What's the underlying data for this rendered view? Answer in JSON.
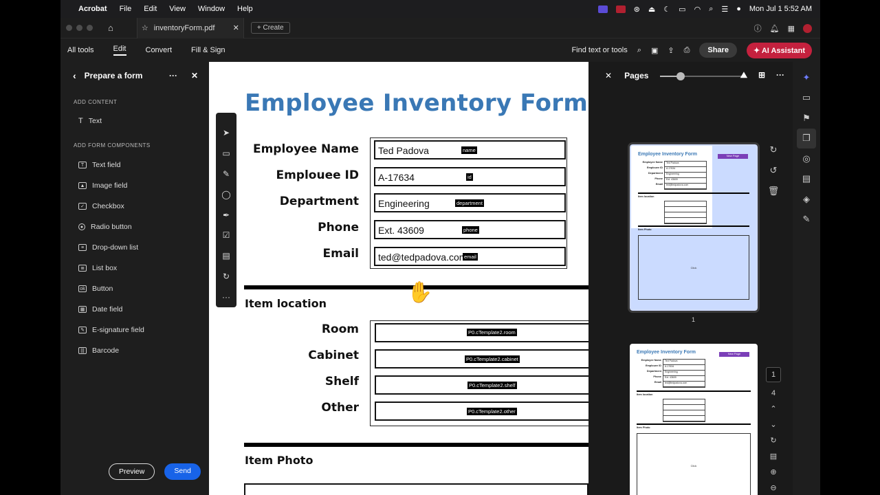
{
  "menubar": {
    "app": "Acrobat",
    "items": [
      "File",
      "Edit",
      "View",
      "Window",
      "Help"
    ],
    "clock": "Mon Jul 1  5:52 AM"
  },
  "tabbar": {
    "tab_name": "inventoryForm.pdf",
    "create_label": "Create"
  },
  "toolbar": {
    "menus": [
      "All tools",
      "Edit",
      "Convert",
      "Fill & Sign"
    ],
    "active_menu": "Edit",
    "find_label": "Find text or tools",
    "share_label": "Share",
    "ai_label": "AI Assistant"
  },
  "left_panel": {
    "title": "Prepare a form",
    "section_content": "ADD CONTENT",
    "content_items": [
      "Text"
    ],
    "section_components": "ADD FORM COMPONENTS",
    "components": [
      "Text field",
      "Image field",
      "Checkbox",
      "Radio button",
      "Drop-down list",
      "List box",
      "Button",
      "Date field",
      "E-signature field",
      "Barcode"
    ],
    "preview_label": "Preview",
    "send_label": "Send"
  },
  "document": {
    "title": "Employee Inventory Form",
    "fields": [
      {
        "label": "Employee Name",
        "value": "Ted Padova",
        "tag": "name"
      },
      {
        "label": "Emplouee ID",
        "value": "A-17634",
        "tag": "id"
      },
      {
        "label": "Department",
        "value": "Engineering",
        "tag": "department"
      },
      {
        "label": "Phone",
        "value": "Ext. 43609",
        "tag": "phone"
      },
      {
        "label": "Email",
        "value": "ted@tedpadova.com",
        "tag": "email"
      }
    ],
    "item_location": "Item location",
    "location_fields": [
      {
        "label": "Room",
        "tag": "P0.cTemplate2.room"
      },
      {
        "label": "Cabinet",
        "tag": "P0.cTemplate2.cabinet"
      },
      {
        "label": "Shelf",
        "tag": "P0.cTemplate2.shelf"
      },
      {
        "label": "Other",
        "tag": "P0.cTemplate2.other"
      }
    ],
    "item_photo": "Item Photo"
  },
  "right_panel": {
    "title": "Pages",
    "thumb_title": "Employee Inventory Form",
    "thumb_new_page": "New Page",
    "page1_label": "1",
    "current_page": "1",
    "total_pages": "4",
    "photo_click": "Click"
  }
}
